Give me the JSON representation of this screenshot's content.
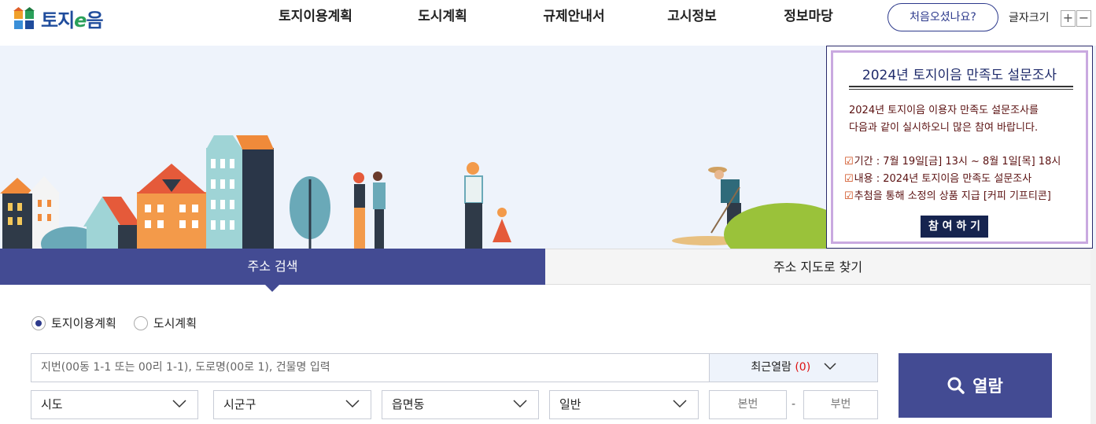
{
  "header": {
    "logo_text_a": "토지",
    "logo_text_e": "e",
    "logo_text_b": "음",
    "nav": [
      "토지이용계획",
      "도시계획",
      "규제안내서",
      "고시정보",
      "정보마당"
    ],
    "first_visit_label": "처음오셨나요?",
    "font_size_label": "글자크기",
    "font_plus": "+",
    "font_minus": "−"
  },
  "tabs": [
    {
      "label": "주소 검색",
      "active": true
    },
    {
      "label": "주소 지도로 찾기",
      "active": false
    }
  ],
  "search": {
    "radios": [
      {
        "label": "토지이용계획",
        "checked": true
      },
      {
        "label": "도시계획",
        "checked": false
      }
    ],
    "placeholder": "지번(00동 1-1 또는 00리 1-1), 도로명(00로 1), 건물명 입력",
    "recent_label": "최근열람",
    "recent_count": "(0)",
    "view_label": "열람",
    "selects": [
      "시도",
      "시군구",
      "읍면동",
      "일반"
    ],
    "main_no": "본번",
    "dash": "-",
    "sub_no": "부번"
  },
  "popup": {
    "title": "2024년 토지이음 만족도 설문조사",
    "intro1": "2024년 토지이음 이용자 만족도 설문조사를",
    "intro2": "다음과 같이 실시하오니 많은 참여 바랍니다.",
    "item1": "기간 : 7월 19일[금] 13시 ~ 8월 1일[목] 18시",
    "item2": "내용 : 2024년 토지이음 만족도 설문조사",
    "item3": "추첨을 통해 소정의 상품 지급 [커피 기프티콘]",
    "button": "참 여 하 기"
  }
}
